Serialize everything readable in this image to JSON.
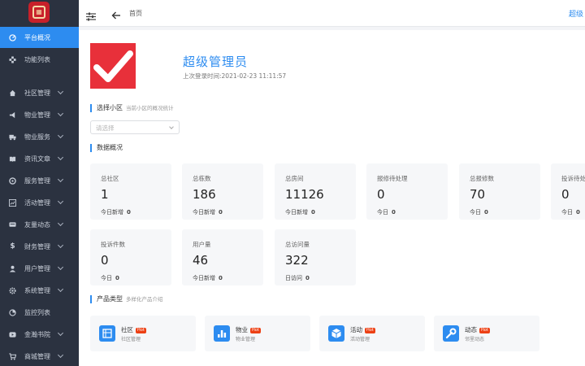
{
  "sidebar": {
    "items": [
      {
        "label": "平台概况",
        "icon": "dashboard-icon",
        "active": true
      },
      {
        "label": "功能列表",
        "icon": "grid-icon",
        "active": false
      },
      {
        "label": "社区管理",
        "icon": "home-icon"
      },
      {
        "label": "物业管理",
        "icon": "megaphone-icon"
      },
      {
        "label": "物业服务",
        "icon": "truck-icon"
      },
      {
        "label": "资讯文章",
        "icon": "book-icon"
      },
      {
        "label": "服务管理",
        "icon": "settings-icon"
      },
      {
        "label": "活动管理",
        "icon": "chart-icon"
      },
      {
        "label": "友量动态",
        "icon": "message-icon"
      },
      {
        "label": "财务管理",
        "icon": "dollar-icon"
      },
      {
        "label": "用户管理",
        "icon": "user-icon"
      },
      {
        "label": "系统管理",
        "icon": "cog-icon"
      },
      {
        "label": "监控列表",
        "icon": "monitor-icon"
      },
      {
        "label": "金瀚书院",
        "icon": "video-icon"
      },
      {
        "label": "商城管理",
        "icon": "cart-icon"
      }
    ]
  },
  "topbar": {
    "breadcrumb": "首页",
    "user": "超级"
  },
  "profile": {
    "name": "超级管理员",
    "last_login": "上次登录时间:2021-02-23 11:11:57"
  },
  "community_select": {
    "title": "选择小区",
    "subtitle": "当前小区的概况统计",
    "placeholder": "请选择"
  },
  "overview": {
    "title": "数据概况",
    "stats": [
      {
        "label": "总社区",
        "value": "1",
        "foot_label": "今日新增",
        "foot_value": "0"
      },
      {
        "label": "总栋数",
        "value": "186",
        "foot_label": "今日新增",
        "foot_value": "0"
      },
      {
        "label": "总房间",
        "value": "11126",
        "foot_label": "今日新增",
        "foot_value": "0"
      },
      {
        "label": "报修待处理",
        "value": "0",
        "foot_label": "今日",
        "foot_value": "0"
      },
      {
        "label": "总报修数",
        "value": "70",
        "foot_label": "今日",
        "foot_value": "0"
      },
      {
        "label": "投诉待处",
        "value": "0",
        "foot_label": "今日",
        "foot_value": "0"
      },
      {
        "label": "投诉件数",
        "value": "0",
        "foot_label": "今日",
        "foot_value": "0"
      },
      {
        "label": "用户量",
        "value": "46",
        "foot_label": "今日新增",
        "foot_value": "0"
      },
      {
        "label": "总访问量",
        "value": "322",
        "foot_label": "日访问",
        "foot_value": "0"
      }
    ]
  },
  "products": {
    "title": "产品类型",
    "subtitle": "多样化产品介绍",
    "items": [
      {
        "name": "社区",
        "badge": "Hot",
        "desc": "社区管理",
        "icon": "building-icon"
      },
      {
        "name": "物业",
        "badge": "Hot",
        "desc": "物业管理",
        "icon": "bar-chart-icon"
      },
      {
        "name": "活动",
        "badge": "Hot",
        "desc": "活动管理",
        "icon": "cube-icon"
      },
      {
        "name": "动态",
        "badge": "Hot",
        "desc": "邻里动态",
        "icon": "wrench-icon"
      }
    ]
  },
  "colors": {
    "sidebar_bg": "#2b3240",
    "accent": "#2d8cf0",
    "avatar": "#e8303a",
    "hot_badge": "#ed4014"
  }
}
